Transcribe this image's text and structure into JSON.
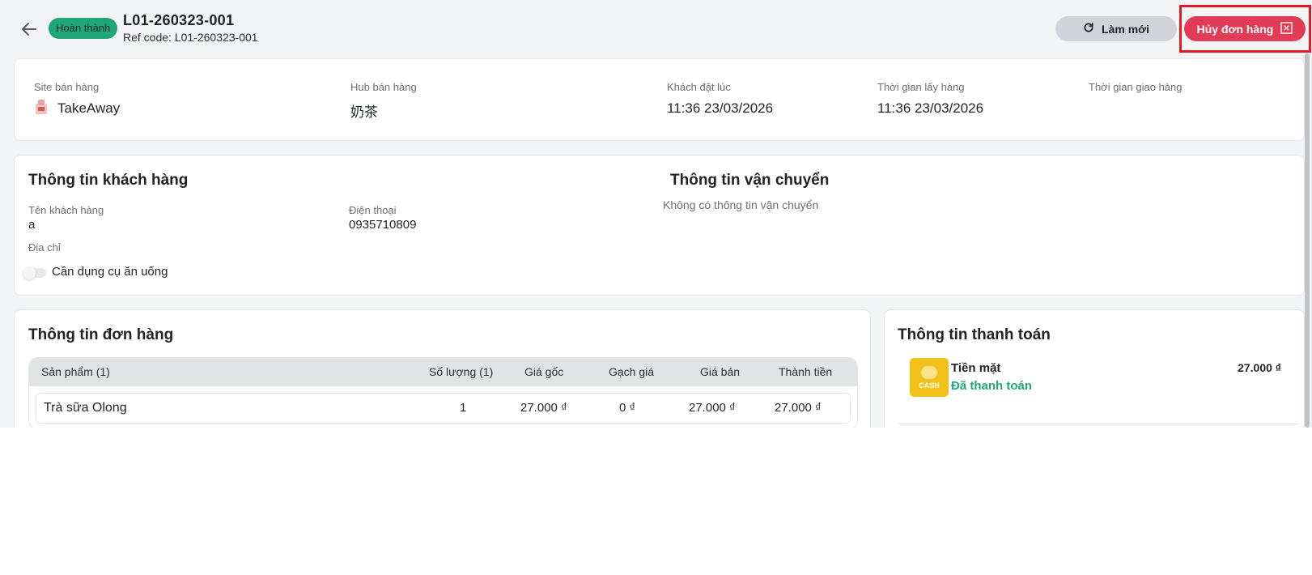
{
  "header": {
    "status": "Hoàn thành",
    "order_code": "L01-260323-001",
    "ref_code": "Ref code: L01-260323-001",
    "refresh_label": "Làm mới",
    "cancel_label": "Hủy đơn hàng"
  },
  "summary": {
    "site_label": "Site bán hàng",
    "site_value": "TakeAway",
    "hub_label": "Hub bán hàng",
    "hub_value": "奶茶",
    "ordered_label": "Khách đặt lúc",
    "ordered_value": "11:36 23/03/2026",
    "pickup_label": "Thời gian lấy hàng",
    "pickup_value": "11:36 23/03/2026",
    "delivery_label": "Thời gian giao hàng"
  },
  "customer": {
    "title": "Thông tin khách hàng",
    "name_label": "Tên khách hàng",
    "name_value": "a",
    "phone_label": "Điện thoại",
    "phone_value": "0935710809",
    "address_label": "Địa chỉ",
    "utensils_label": "Cần dụng cụ ăn uống",
    "utensils_on": false
  },
  "shipping": {
    "title": "Thông tin vận chuyển",
    "empty_text": "Không có thông tin vận chuyển"
  },
  "order": {
    "title": "Thông tin đơn hàng",
    "columns": [
      "Sản phẩm (1)",
      "Số lượng (1)",
      "Giá gốc",
      "Gạch giá",
      "Giá bán",
      "Thành tiền"
    ],
    "rows": [
      [
        "Trà sữa Olong",
        "1",
        "27.000 ₫",
        "0 ₫",
        "27.000 ₫",
        "27.000 ₫"
      ]
    ]
  },
  "payment": {
    "title": "Thông tin thanh toán",
    "method": "Tiền mặt",
    "status": "Đã thanh toán",
    "amount": "27.000 ₫",
    "cash_icon_text": "CASH"
  },
  "colors": {
    "status_badge": "#1fa77a",
    "cancel_button": "#e23b55",
    "highlight": "#e41b23",
    "paid_green": "#1fa77a"
  }
}
